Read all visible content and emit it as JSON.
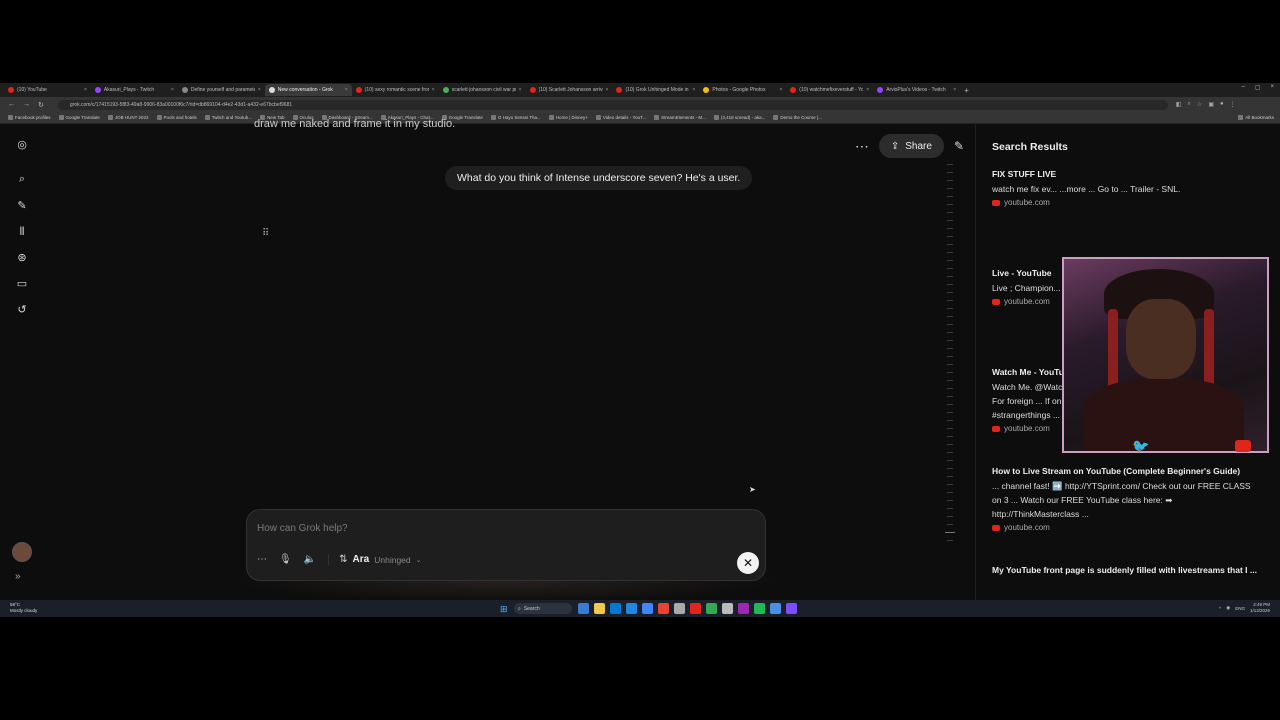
{
  "browser": {
    "tabs": [
      {
        "label": "(10) YouTube",
        "color": "#e0251b",
        "active": false
      },
      {
        "label": "Akasuri_Plays - Twitch",
        "color": "#9146ff",
        "active": false
      },
      {
        "label": "Define yourself and parameter...",
        "color": "#888888",
        "active": false
      },
      {
        "label": "New conversation - Grok",
        "color": "#dddddd",
        "active": true
      },
      {
        "label": "(10) sexy romantic scene from...",
        "color": "#e0251b",
        "active": false
      },
      {
        "label": "scarlett johansson civil war pr...",
        "color": "#4caf50",
        "active": false
      },
      {
        "label": "(10) Scarlett Johansson arrive...",
        "color": "#e0251b",
        "active": false
      },
      {
        "label": "(10) Grok Unhinged Mode in 1...",
        "color": "#e0251b",
        "active": false
      },
      {
        "label": "Photos - Google Photos",
        "color": "#fbbc05",
        "active": false
      },
      {
        "label": "(10) watchmefixeverstuff - YouTube",
        "color": "#e0251b",
        "active": false
      },
      {
        "label": "ArvisPlus's Videos - Twitch",
        "color": "#9146ff",
        "active": false
      }
    ],
    "url": "grok.com/c/17415193-5f83-49a8-9906-83a00100f6c7/rid=db869104-d4e2-43d1-a432-e67bcbef9681",
    "bookmarks": [
      "Facebook profiles",
      "Google Translate",
      "JOB HUNT 2023",
      "Pools and hotels",
      "Twitch and Youtub...",
      "New Tab",
      "Oculus",
      "Dashboard - Stream...",
      "Akasuri_Plays - Chat...",
      "Google Translate",
      "O Hayo Sensei Tha...",
      "Home | Disney+",
      "Video details - YouT...",
      "StreamElements - M...",
      "(3,418 unread) - aka...",
      "Demo the Course (...",
      "All Bookmarks"
    ]
  },
  "leftnav": {
    "items": [
      "grok-logo-icon",
      "search-icon",
      "new-chat-icon",
      "voice-icon",
      "imagine-icon",
      "projects-icon",
      "history-icon"
    ]
  },
  "chat": {
    "cut_off_text": "draw me naked and frame it in my studio.",
    "user_message": "What do you think of Intense underscore seven? He's a user.",
    "share_label": "Share",
    "loading": "⠿",
    "composer": {
      "placeholder": "How can Grok help?",
      "model_name": "Ara",
      "model_mode": "Unhinged"
    }
  },
  "search_panel": {
    "title": "Search Results",
    "results": [
      {
        "title": "FIX STUFF LIVE",
        "snippet": "watch me fix ev... ...more ... Go to ... Trailer - SNL.",
        "source": "youtube.com"
      },
      {
        "title": "Live - YouTube",
        "snippet": "Live ; Champion... NASCAR. 14K w... news conference.",
        "source": "youtube.com"
      },
      {
        "title": "Watch Me - YouTube",
        "snippet": "Watch Me. @WatchMeOff. 14.2M subscribers•1.9K videos. Contacts For foreign ... If only Stranger Things happened in the real world! #strangerthings ...",
        "source": "youtube.com"
      },
      {
        "title": "How to Live Stream on YouTube (Complete Beginner's Guide)",
        "snippet": "... channel fast! ➡️ http://YTSprint.com/ Check out our FREE CLASS on 3 ... Watch our FREE YouTube class here: ➡ http://ThinkMasterclass ...",
        "source": "youtube.com"
      },
      {
        "title": "My YouTube front page is suddenly filled with livestreams that I ...",
        "snippet": "",
        "source": ""
      }
    ]
  },
  "taskbar": {
    "weather_temp": "58°C",
    "weather_desc": "Mostly cloudy",
    "search_label": "Search",
    "clock_time": "2:49 PM",
    "clock_date": "1/13/2026",
    "lang": "ENG"
  }
}
